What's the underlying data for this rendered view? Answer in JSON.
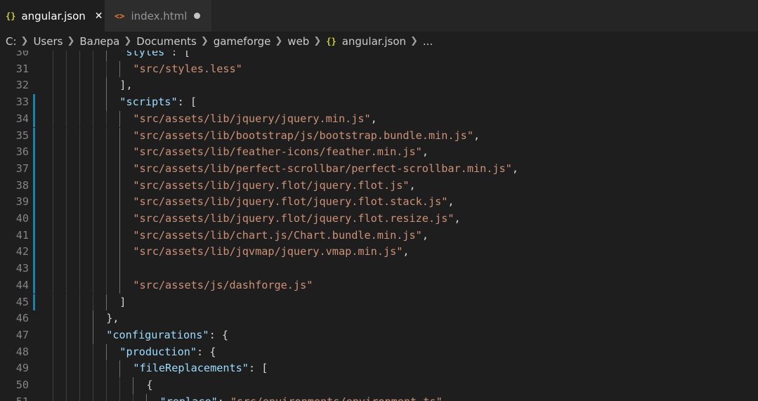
{
  "tabs": [
    {
      "label": "angular.json",
      "icon": "{}",
      "active": true,
      "dirty": false
    },
    {
      "label": "index.html",
      "icon": "<>",
      "active": false,
      "dirty": true
    }
  ],
  "breadcrumb": {
    "items": [
      "C:",
      "Users",
      "Валера",
      "Documents",
      "gameforge",
      "web",
      "angular.json",
      "..."
    ],
    "file_icon": "{}"
  },
  "colors": {
    "editor_bg": "#1e1e1e",
    "key": "#9cdcfe",
    "string": "#ce9178",
    "punct": "#d4d4d4",
    "line_number": "#858585",
    "gutter_modified": "#1b81a8",
    "json_icon": "#cbcb41",
    "html_icon": "#e37933"
  },
  "editor": {
    "lines": [
      {
        "n": "30",
        "indent": 6,
        "mod": false,
        "tokens": [
          [
            "k",
            "\"styles\""
          ],
          [
            "p",
            ": ["
          ]
        ]
      },
      {
        "n": "31",
        "indent": 7,
        "mod": false,
        "tokens": [
          [
            "s",
            "\"src/styles.less\""
          ]
        ]
      },
      {
        "n": "32",
        "indent": 6,
        "mod": false,
        "tokens": [
          [
            "p",
            "],"
          ]
        ]
      },
      {
        "n": "33",
        "indent": 6,
        "mod": true,
        "tokens": [
          [
            "k",
            "\"scripts\""
          ],
          [
            "p",
            ": ["
          ]
        ]
      },
      {
        "n": "34",
        "indent": 7,
        "mod": true,
        "tokens": [
          [
            "s",
            "\"src/assets/lib/jquery/jquery.min.js\""
          ],
          [
            "p",
            ","
          ]
        ]
      },
      {
        "n": "35",
        "indent": 7,
        "mod": true,
        "tokens": [
          [
            "s",
            "\"src/assets/lib/bootstrap/js/bootstrap.bundle.min.js\""
          ],
          [
            "p",
            ","
          ]
        ]
      },
      {
        "n": "36",
        "indent": 7,
        "mod": true,
        "tokens": [
          [
            "s",
            "\"src/assets/lib/feather-icons/feather.min.js\""
          ],
          [
            "p",
            ","
          ]
        ]
      },
      {
        "n": "37",
        "indent": 7,
        "mod": true,
        "tokens": [
          [
            "s",
            "\"src/assets/lib/perfect-scrollbar/perfect-scrollbar.min.js\""
          ],
          [
            "p",
            ","
          ]
        ]
      },
      {
        "n": "38",
        "indent": 7,
        "mod": true,
        "tokens": [
          [
            "s",
            "\"src/assets/lib/jquery.flot/jquery.flot.js\""
          ],
          [
            "p",
            ","
          ]
        ]
      },
      {
        "n": "39",
        "indent": 7,
        "mod": true,
        "tokens": [
          [
            "s",
            "\"src/assets/lib/jquery.flot/jquery.flot.stack.js\""
          ],
          [
            "p",
            ","
          ]
        ]
      },
      {
        "n": "40",
        "indent": 7,
        "mod": true,
        "tokens": [
          [
            "s",
            "\"src/assets/lib/jquery.flot/jquery.flot.resize.js\""
          ],
          [
            "p",
            ","
          ]
        ]
      },
      {
        "n": "41",
        "indent": 7,
        "mod": true,
        "tokens": [
          [
            "s",
            "\"src/assets/lib/chart.js/Chart.bundle.min.js\""
          ],
          [
            "p",
            ","
          ]
        ]
      },
      {
        "n": "42",
        "indent": 7,
        "mod": true,
        "tokens": [
          [
            "s",
            "\"src/assets/lib/jqvmap/jquery.vmap.min.js\""
          ],
          [
            "p",
            ","
          ]
        ]
      },
      {
        "n": "43",
        "indent": 7,
        "mod": true,
        "tokens": []
      },
      {
        "n": "44",
        "indent": 7,
        "mod": true,
        "tokens": [
          [
            "s",
            "\"src/assets/js/dashforge.js\""
          ]
        ]
      },
      {
        "n": "45",
        "indent": 6,
        "mod": true,
        "tokens": [
          [
            "p",
            "]"
          ]
        ]
      },
      {
        "n": "46",
        "indent": 5,
        "mod": false,
        "tokens": [
          [
            "p",
            "},"
          ]
        ]
      },
      {
        "n": "47",
        "indent": 5,
        "mod": false,
        "tokens": [
          [
            "k",
            "\"configurations\""
          ],
          [
            "p",
            ": {"
          ]
        ]
      },
      {
        "n": "48",
        "indent": 6,
        "mod": false,
        "tokens": [
          [
            "k",
            "\"production\""
          ],
          [
            "p",
            ": {"
          ]
        ]
      },
      {
        "n": "49",
        "indent": 7,
        "mod": false,
        "tokens": [
          [
            "k",
            "\"fileReplacements\""
          ],
          [
            "p",
            ": ["
          ]
        ]
      },
      {
        "n": "50",
        "indent": 8,
        "mod": false,
        "tokens": [
          [
            "p",
            "{"
          ]
        ]
      },
      {
        "n": "51",
        "indent": 9,
        "mod": false,
        "tokens": [
          [
            "k",
            "\"replace\""
          ],
          [
            "p",
            ": "
          ],
          [
            "s",
            "\"src/environments/environment.ts\""
          ],
          [
            "p",
            ","
          ]
        ]
      }
    ]
  }
}
